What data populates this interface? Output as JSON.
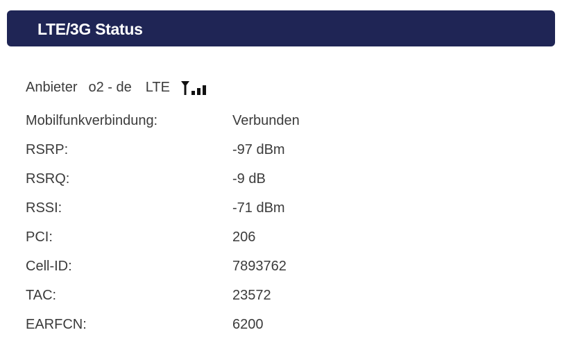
{
  "header": {
    "title": "LTE/3G Status"
  },
  "provider": {
    "label": "Anbieter",
    "name": "o2 - de",
    "technology": "LTE",
    "signal_icon": "signal-strength-icon",
    "signal_bars_active": 3,
    "signal_bars_total": 3
  },
  "colors": {
    "header_bg": "#1f2555",
    "header_text": "#ffffff",
    "text": "#3b3b3b"
  },
  "rows": [
    {
      "label": "Mobilfunkverbindung:",
      "value": "Verbunden"
    },
    {
      "label": "RSRP:",
      "value": "-97 dBm"
    },
    {
      "label": "RSRQ:",
      "value": "-9 dB"
    },
    {
      "label": "RSSI:",
      "value": "-71 dBm"
    },
    {
      "label": "PCI:",
      "value": "206"
    },
    {
      "label": "Cell-ID:",
      "value": "7893762"
    },
    {
      "label": "TAC:",
      "value": "23572"
    },
    {
      "label": "EARFCN:",
      "value": "6200"
    }
  ]
}
